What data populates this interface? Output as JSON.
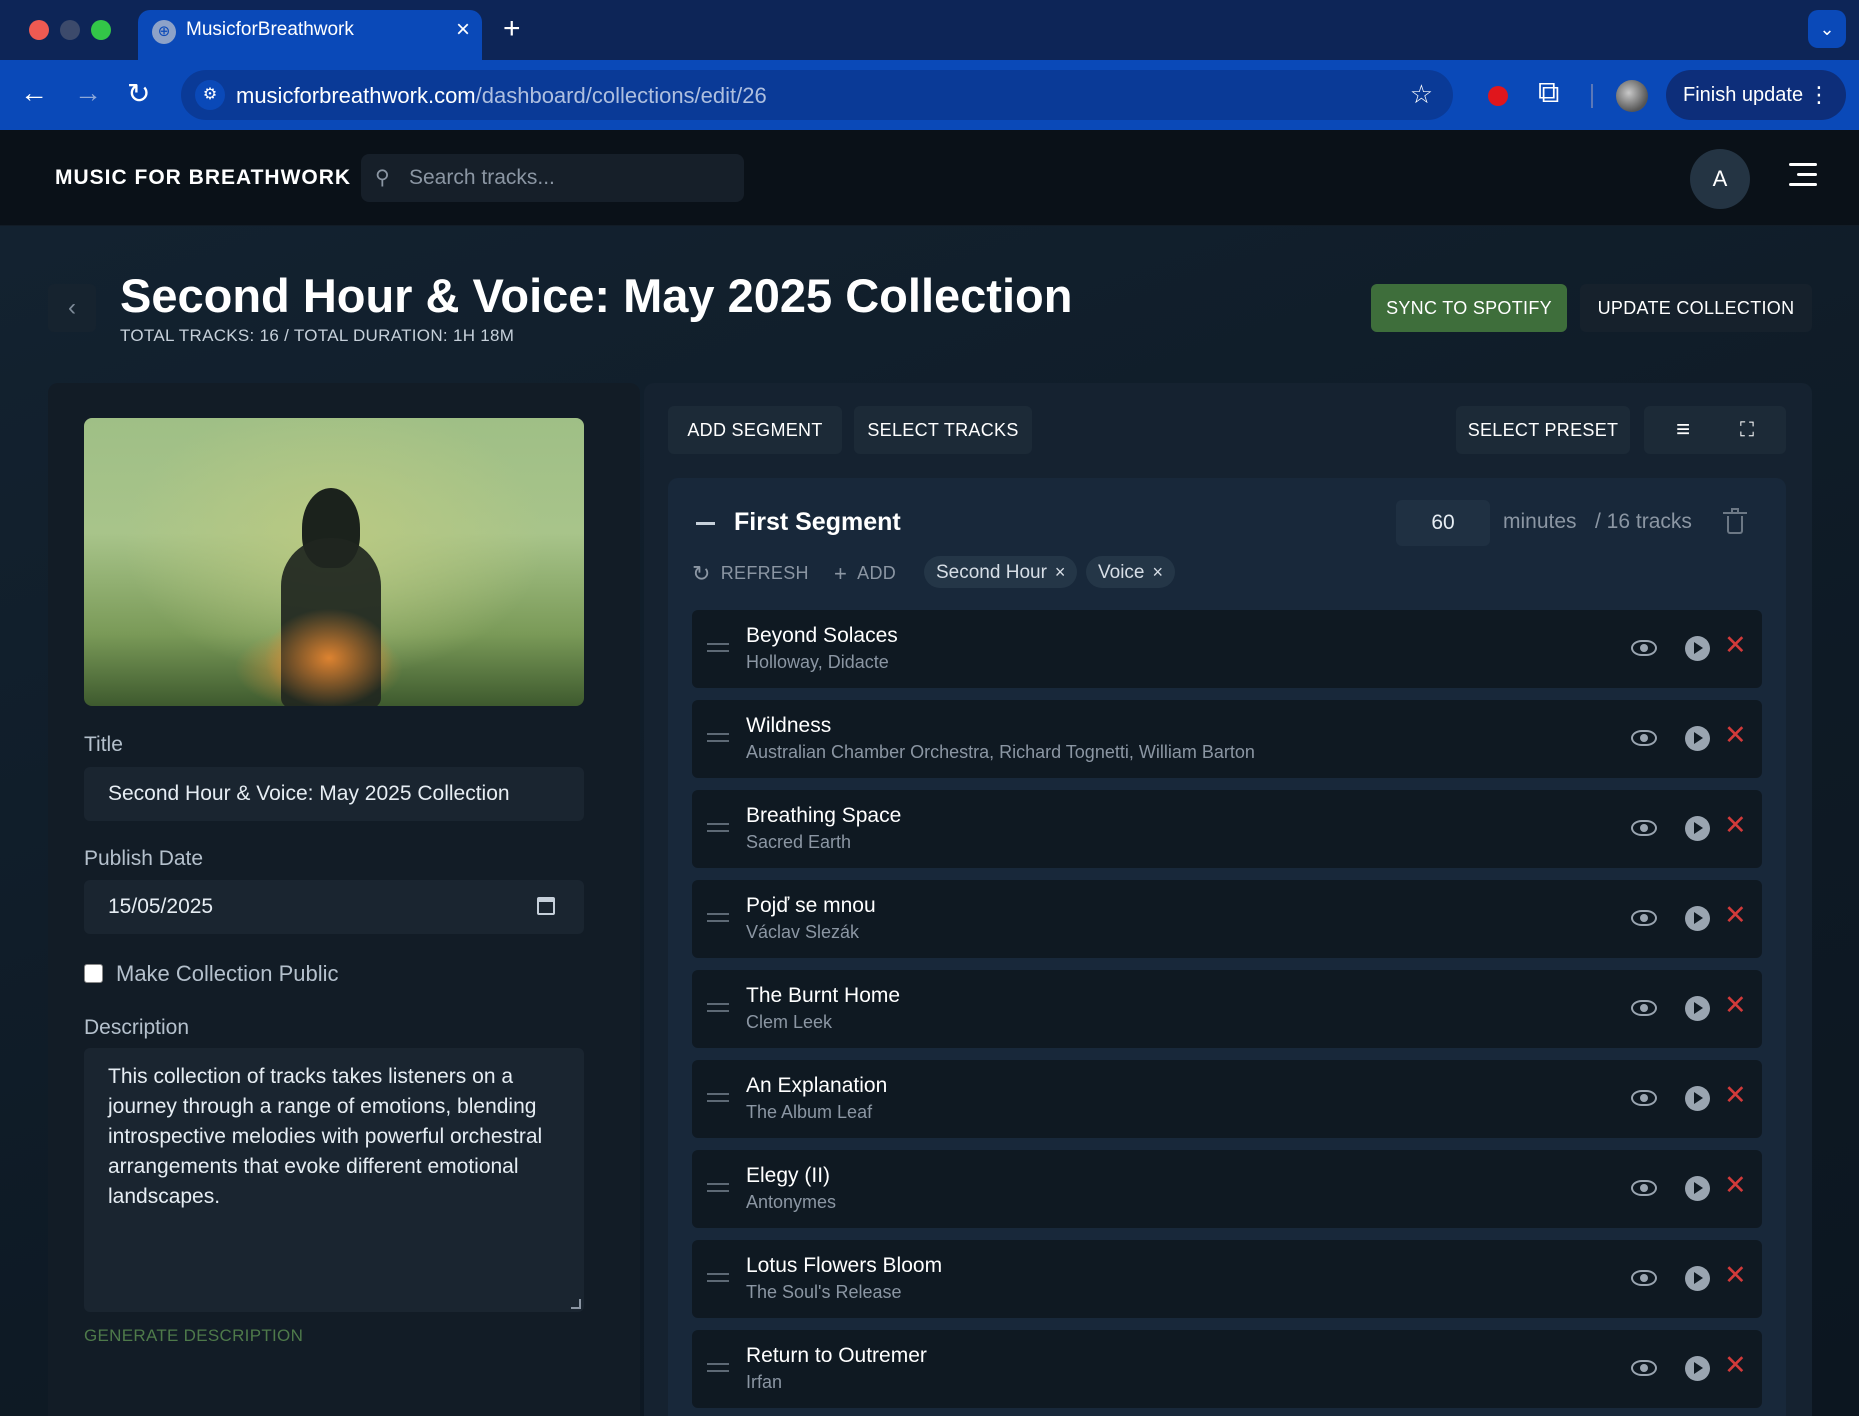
{
  "browser": {
    "tab_title": "MusicforBreathwork",
    "url_host": "musicforbreathwork.com",
    "url_path": "/dashboard/collections/edit/26",
    "finish_update_label": "Finish update"
  },
  "header": {
    "brand": "MUSIC FOR BREATHWORK",
    "search_placeholder": "Search tracks...",
    "avatar_initial": "A"
  },
  "page": {
    "title": "Second Hour & Voice: May 2025 Collection",
    "meta": "TOTAL TRACKS: 16 /   TOTAL DURATION: 1H 18M",
    "sync_label": "SYNC TO SPOTIFY",
    "update_label": "UPDATE COLLECTION"
  },
  "form": {
    "title_label": "Title",
    "title_value": "Second Hour & Voice: May 2025 Collection",
    "publish_label": "Publish Date",
    "publish_value": "15/05/2025",
    "public_label": "Make Collection Public",
    "public_checked": false,
    "description_label": "Description",
    "description_value": "This collection of tracks takes listeners on a journey through a range of emotions, blending introspective melodies with powerful orchestral arrangements that evoke different emotional landscapes.",
    "generate_label": "GENERATE DESCRIPTION"
  },
  "toolbar": {
    "add_segment": "ADD SEGMENT",
    "select_tracks": "SELECT TRACKS",
    "select_preset": "SELECT PRESET",
    "list_icon": "≡",
    "expand_icon": "⛶"
  },
  "segment": {
    "title": "First Segment",
    "minutes_value": "60",
    "minutes_label": "minutes",
    "tracks_label": "/ 16 tracks",
    "refresh_label": "REFRESH",
    "add_label": "ADD",
    "tags": [
      "Second Hour",
      "Voice"
    ]
  },
  "tracks": [
    {
      "title": "Beyond Solaces",
      "artist": "Holloway, Didacte"
    },
    {
      "title": "Wildness",
      "artist": "Australian Chamber Orchestra, Richard Tognetti, William Barton"
    },
    {
      "title": "Breathing Space",
      "artist": "Sacred Earth"
    },
    {
      "title": "Pojď se mnou",
      "artist": "Václav Slezák"
    },
    {
      "title": "The Burnt Home",
      "artist": "Clem Leek"
    },
    {
      "title": "An Explanation",
      "artist": "The Album Leaf"
    },
    {
      "title": "Elegy (II)",
      "artist": "Antonymes"
    },
    {
      "title": "Lotus Flowers Bloom",
      "artist": "The Soul's Release"
    },
    {
      "title": "Return to Outremer",
      "artist": "Irfan"
    }
  ],
  "colors": {
    "accent_green": "#3e6e3b",
    "remove_red": "#d13a3a",
    "browser_blue": "#0a49b8"
  }
}
